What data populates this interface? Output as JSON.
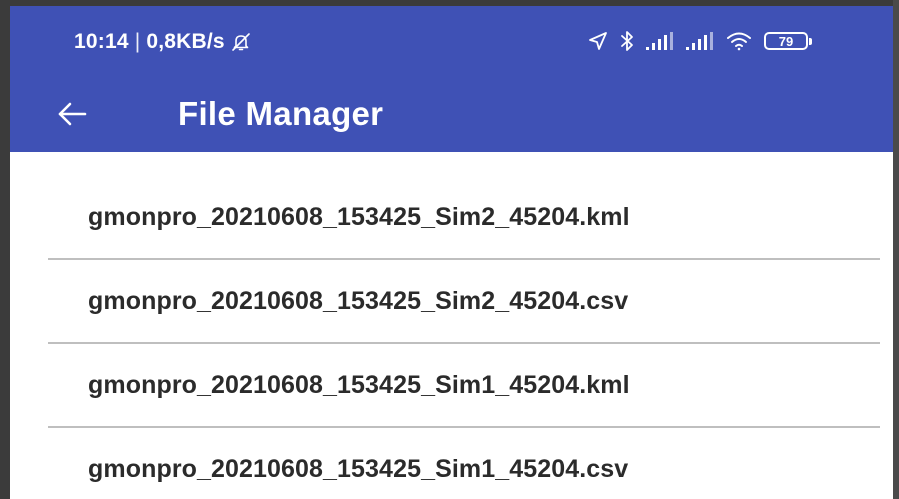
{
  "status_bar": {
    "time": "10:14",
    "separator": "|",
    "network_speed": "0,8KB/s",
    "battery_level": "79",
    "icons": [
      "mute-icon",
      "location-icon",
      "bluetooth-icon",
      "signal-icon",
      "signal-icon",
      "wifi-icon",
      "battery-icon"
    ]
  },
  "toolbar": {
    "back_icon": "arrow-left-icon",
    "title": "File Manager"
  },
  "files": [
    {
      "name": "gmonpro_20210608_153425_Sim2_45204.kml"
    },
    {
      "name": "gmonpro_20210608_153425_Sim2_45204.csv"
    },
    {
      "name": "gmonpro_20210608_153425_Sim1_45204.kml"
    },
    {
      "name": "gmonpro_20210608_153425_Sim1_45204.csv"
    }
  ],
  "colors": {
    "app_bar": "#3f51b5",
    "text_on_primary": "#ffffff",
    "list_text": "#2b2b2b",
    "divider": "#bfbfbf"
  }
}
